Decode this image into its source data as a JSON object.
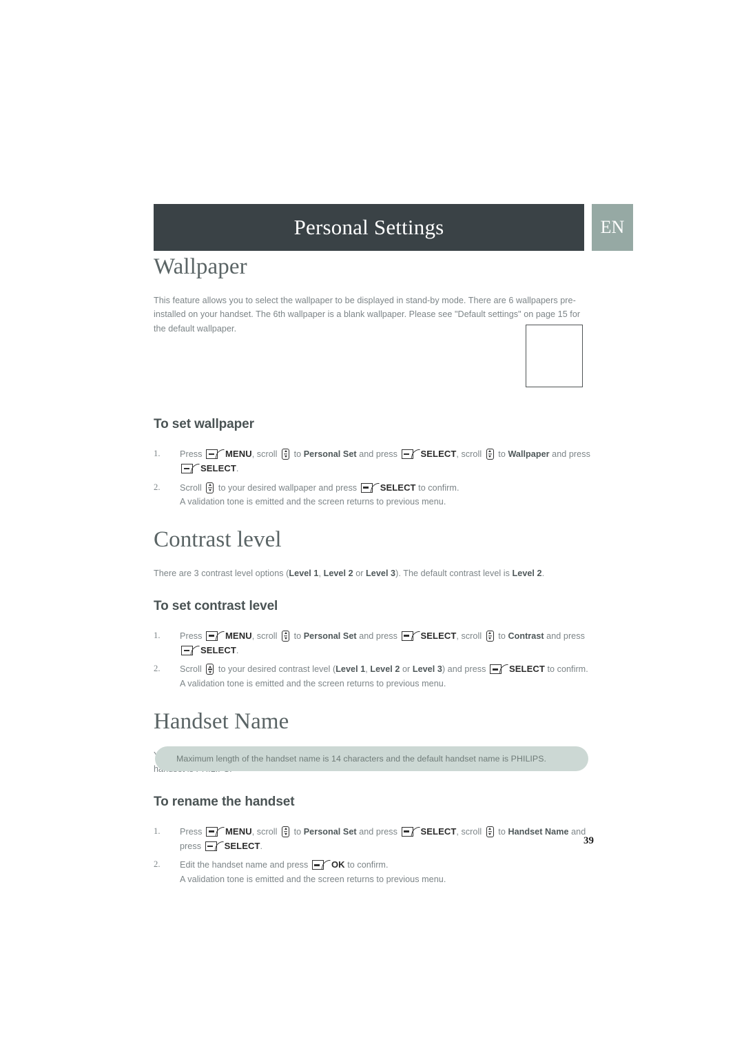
{
  "header": {
    "title": "Personal Settings",
    "language_badge": "EN",
    "bar_color": "#3a4246",
    "badge_color": "#96a9a4"
  },
  "icons": {
    "softkey": "softkey-icon",
    "scroll": "scroll-updown-icon"
  },
  "sections": {
    "wallpaper": {
      "heading": "Wallpaper",
      "intro_1": "This feature allows you to select the wallpaper to be displayed in stand-by mode. There are 6 wallpapers pre-installed on your handset. The 6th wallpaper is a blank wallpaper. Please see \"Default settings\" on page ",
      "intro_page_ref": "15",
      "intro_2": " for the default wallpaper.",
      "sub_heading": "To set wallpaper",
      "step1": {
        "num": "1.",
        "t1": "Press ",
        "k1": "MENU",
        "t2": ", scroll ",
        "t3": " to ",
        "b1": "Personal Set",
        "t4": " and press ",
        "k2": "SELECT",
        "t5": ", scroll ",
        "t6": " to ",
        "b2": "Wallpaper",
        "t7": " and press ",
        "k3": "SELECT",
        "t8": "."
      },
      "step2": {
        "num": "2.",
        "t1": "Scroll ",
        "t2": " to your desired wallpaper and press ",
        "k1": "SELECT",
        "t3": " to confirm.",
        "sub": "A validation tone is emitted and the screen returns to previous menu."
      }
    },
    "contrast": {
      "heading": "Contrast level",
      "intro_a": "There are 3 contrast level options (",
      "lvl1": "Level 1",
      "intro_b": ", ",
      "lvl2": "Level 2",
      "intro_c": " or ",
      "lvl3": "Level 3",
      "intro_d": "). The default contrast level is ",
      "default_level": "Level 2",
      "intro_e": ".",
      "sub_heading": "To set contrast level",
      "step1": {
        "num": "1.",
        "t1": "Press ",
        "k1": "MENU",
        "t2": ", scroll ",
        "t3": " to ",
        "b1": "Personal Set",
        "t4": " and press ",
        "k2": "SELECT",
        "t5": ", scroll ",
        "t6": " to ",
        "b2": "Contrast",
        "t7": " and press ",
        "k3": "SELECT",
        "t8": "."
      },
      "step2": {
        "num": "2.",
        "t1": "Scroll ",
        "t2": " to your desired contrast level (",
        "b1": "Level 1",
        "t3": ", ",
        "b2": "Level 2",
        "t4": " or ",
        "b3": "Level 3",
        "t5": ") and press ",
        "k1": "SELECT",
        "t6": " to confirm.",
        "sub": "A validation tone is emitted and the screen returns to previous menu."
      }
    },
    "handset_name": {
      "heading": "Handset Name",
      "intro": "You can name the handset and display the handset name in stand-by mode. The default handset name of your handset is PHILIPS.",
      "sub_heading": "To rename the handset",
      "step1": {
        "num": "1.",
        "t1": "Press ",
        "k1": "MENU",
        "t2": ", scroll ",
        "t3": " to ",
        "b1": "Personal Set",
        "t4": " and press ",
        "k2": "SELECT",
        "t5": ", scroll ",
        "t6": " to ",
        "b2": "Handset Name",
        "t7": " and press ",
        "k3": "SELECT",
        "t8": "."
      },
      "step2": {
        "num": "2.",
        "t1": "Edit the handset name and press ",
        "k1": "OK",
        "t2": " to confirm.",
        "sub": "A validation tone is emitted and the screen returns to previous menu."
      }
    }
  },
  "tip": {
    "text": "Maximum length of the handset name is 14 characters and the default handset name is PHILIPS.",
    "color": "#ccd8d4"
  },
  "folio": {
    "page_number": "39"
  }
}
